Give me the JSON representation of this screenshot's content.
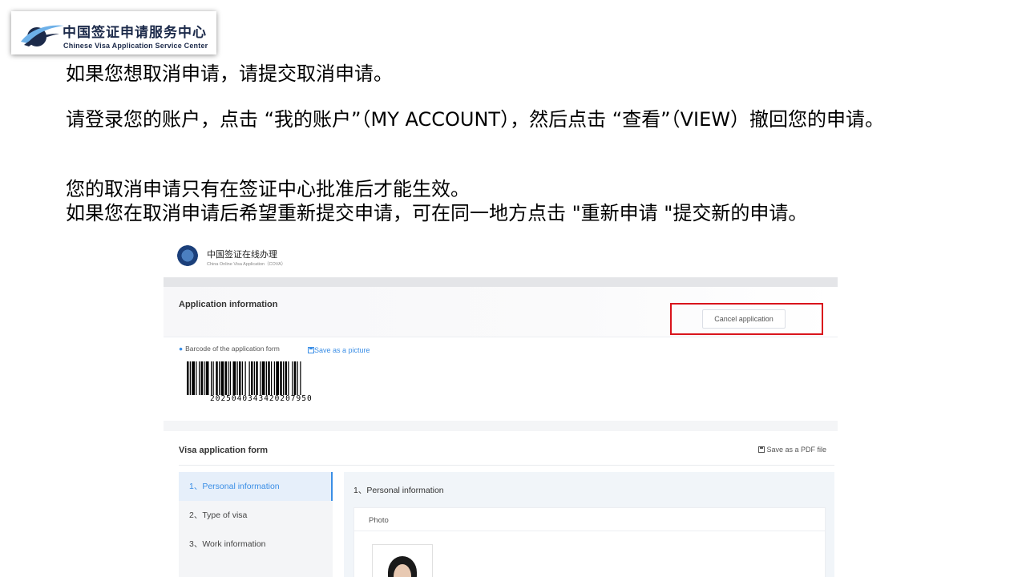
{
  "logo": {
    "name_cn": "中国签证申请服务中心",
    "name_en": "Chinese Visa Application Service Center"
  },
  "instructions": {
    "line1": "如果您想取消申请，请提交取消申请。",
    "line2": "请登录您的账户，点击 “我的账户”（MY ACCOUNT），然后点击 “查看”（VIEW）撤回您的申请。",
    "line3": "您的取消申请只有在签证中心批准后才能生效。",
    "line4": "如果您在取消申请后希望重新提交申请，可在同一地方点击 \"重新申请 \"提交新的申请。"
  },
  "site": {
    "header": {
      "title": "中国签证在线办理",
      "subtitle": "China Online Visa Application（COVA）"
    },
    "application_info": {
      "title": "Application information",
      "cancel_button": "Cancel application",
      "barcode_label": "Barcode of the application form",
      "save_picture": "Save as a picture",
      "barcode_number": "2025040343420207950"
    },
    "visa_form": {
      "title": "Visa application form",
      "save_pdf": "Save as a PDF file",
      "nav": [
        {
          "label": "1、Personal information",
          "active": true
        },
        {
          "label": "2、Type of visa",
          "active": false
        },
        {
          "label": "3、Work information",
          "active": false
        }
      ],
      "section_title": "1、Personal information",
      "photo_label": "Photo"
    }
  },
  "colors": {
    "highlight_box": "#d9141c",
    "link_blue": "#3a8ee6"
  }
}
